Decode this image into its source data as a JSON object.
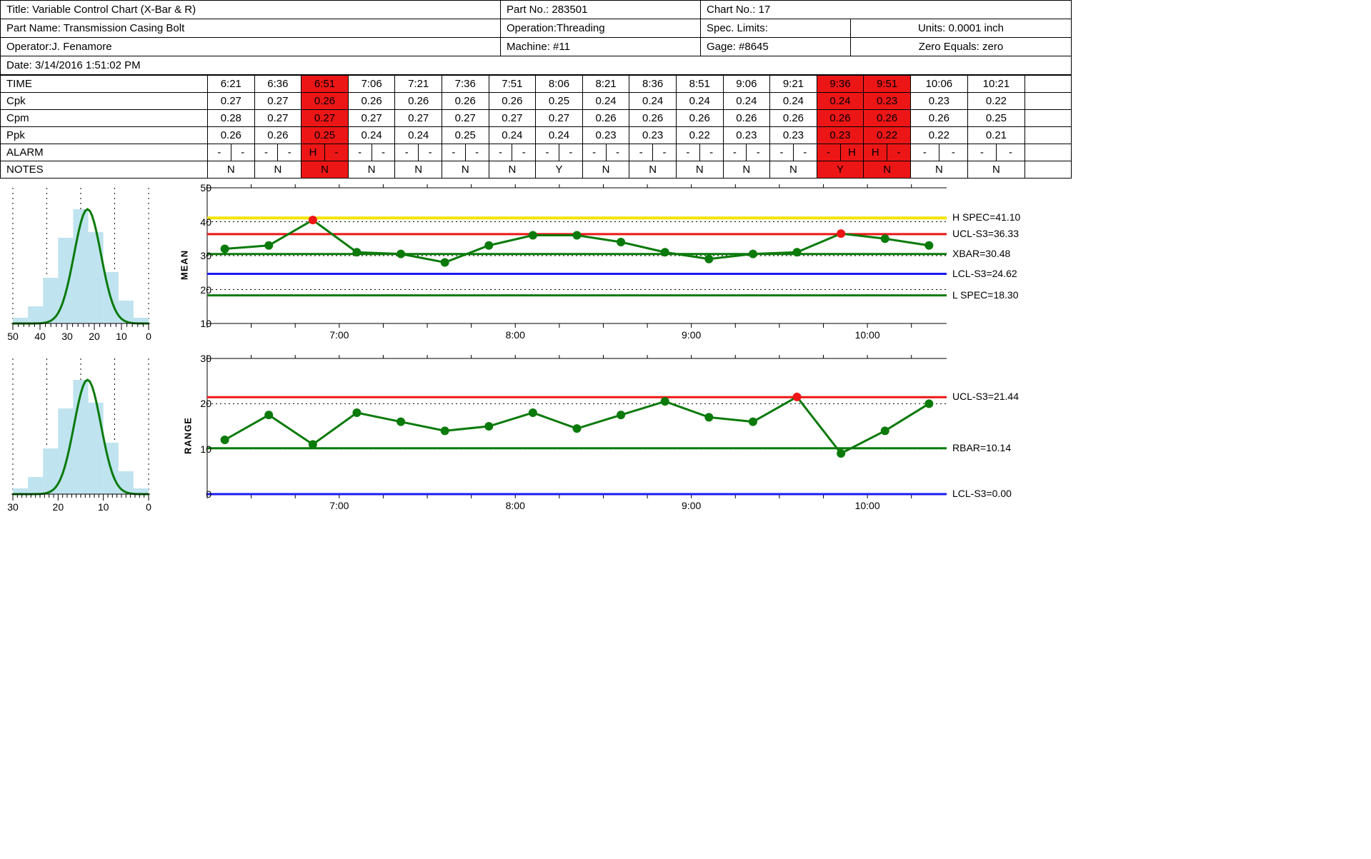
{
  "header": {
    "title": "Title: Variable Control Chart (X-Bar & R)",
    "partno": "Part No.: 283501",
    "chartno": "Chart No.: 17",
    "partname": "Part Name: Transmission Casing Bolt",
    "operation": "Operation:Threading",
    "speclimits": "Spec. Limits:",
    "units": "Units: 0.0001 inch",
    "operator": "Operator:J. Fenamore",
    "machine": "Machine: #11",
    "gage": "Gage: #8645",
    "zero": "Zero Equals: zero",
    "date": "Date: 3/14/2016 1:51:02 PM"
  },
  "rows": {
    "TIME": [
      "6:21",
      "6:36",
      "6:51",
      "7:06",
      "7:21",
      "7:36",
      "7:51",
      "8:06",
      "8:21",
      "8:36",
      "8:51",
      "9:06",
      "9:21",
      "9:36",
      "9:51",
      "10:06",
      "10:21"
    ],
    "Cpk": [
      "0.27",
      "0.27",
      "0.26",
      "0.26",
      "0.26",
      "0.26",
      "0.26",
      "0.25",
      "0.24",
      "0.24",
      "0.24",
      "0.24",
      "0.24",
      "0.24",
      "0.23",
      "0.23",
      "0.22"
    ],
    "Cpm": [
      "0.28",
      "0.27",
      "0.27",
      "0.27",
      "0.27",
      "0.27",
      "0.27",
      "0.27",
      "0.26",
      "0.26",
      "0.26",
      "0.26",
      "0.26",
      "0.26",
      "0.26",
      "0.26",
      "0.25"
    ],
    "Ppk": [
      "0.26",
      "0.26",
      "0.25",
      "0.24",
      "0.24",
      "0.25",
      "0.24",
      "0.24",
      "0.23",
      "0.23",
      "0.22",
      "0.23",
      "0.23",
      "0.23",
      "0.22",
      "0.22",
      "0.21"
    ],
    "ALARM": [
      [
        "-",
        "-"
      ],
      [
        "-",
        "-"
      ],
      [
        "H",
        "-"
      ],
      [
        "-",
        "-"
      ],
      [
        "-",
        "-"
      ],
      [
        "-",
        "-"
      ],
      [
        "-",
        "-"
      ],
      [
        "-",
        "-"
      ],
      [
        "-",
        "-"
      ],
      [
        "-",
        "-"
      ],
      [
        "-",
        "-"
      ],
      [
        "-",
        "-"
      ],
      [
        "-",
        "-"
      ],
      [
        "-",
        "H"
      ],
      [
        "H",
        "-"
      ],
      [
        "-",
        "-"
      ],
      [
        "-",
        "-"
      ]
    ],
    "NOTES": [
      "N",
      "N",
      "N",
      "N",
      "N",
      "N",
      "N",
      "Y",
      "N",
      "N",
      "N",
      "N",
      "N",
      "Y",
      "N",
      "N",
      "N"
    ]
  },
  "alarm_cols": [
    2,
    13,
    14
  ],
  "chart_data": {
    "mean": {
      "type": "line",
      "ylabel": "MEAN",
      "x_min": 6.25,
      "x_max": 10.45,
      "y_min": 10,
      "y_max": 50,
      "x_ticks": [
        7,
        8,
        9,
        10
      ],
      "x_ticklabels": [
        "7:00",
        "8:00",
        "9:00",
        "10:00"
      ],
      "y_ticks": [
        10,
        20,
        30,
        40,
        50
      ],
      "x": [
        6.35,
        6.6,
        6.85,
        7.1,
        7.35,
        7.6,
        7.85,
        8.1,
        8.35,
        8.6,
        8.85,
        9.1,
        9.35,
        9.6,
        9.85,
        10.1,
        10.35
      ],
      "y": [
        32,
        33,
        40.5,
        31,
        30.5,
        28,
        33,
        36,
        36,
        34,
        31,
        29,
        30.5,
        31,
        36.5,
        35,
        33
      ],
      "red_points": [
        2,
        14
      ],
      "lines": [
        {
          "y": 41.1,
          "color": "#f2e400",
          "w": 4,
          "label": "H SPEC=41.10"
        },
        {
          "y": 36.33,
          "color": "#ed1616",
          "w": 3,
          "label": "UCL-S3=36.33"
        },
        {
          "y": 30.48,
          "color": "#0a7a0a",
          "w": 3,
          "label": "XBAR=30.48"
        },
        {
          "y": 24.62,
          "color": "#1a1af2",
          "w": 3,
          "label": "LCL-S3=24.62"
        },
        {
          "y": 18.3,
          "color": "#0a7a0a",
          "w": 3,
          "label": "L SPEC=18.30"
        }
      ]
    },
    "range": {
      "type": "line",
      "ylabel": "RANGE",
      "x_min": 6.25,
      "x_max": 10.45,
      "y_min": 0,
      "y_max": 30,
      "x_ticks": [
        7,
        8,
        9,
        10
      ],
      "x_ticklabels": [
        "7:00",
        "8:00",
        "9:00",
        "10:00"
      ],
      "y_ticks": [
        0,
        10,
        20,
        30
      ],
      "x": [
        6.35,
        6.6,
        6.85,
        7.1,
        7.35,
        7.6,
        7.85,
        8.1,
        8.35,
        8.6,
        8.85,
        9.1,
        9.35,
        9.6,
        9.85,
        10.1,
        10.35
      ],
      "y": [
        12,
        17.5,
        11,
        18,
        16,
        14,
        15,
        18,
        14.5,
        17.5,
        20.5,
        17,
        16,
        21.5,
        9,
        14,
        20
      ],
      "red_points": [
        13
      ],
      "lines": [
        {
          "y": 21.44,
          "color": "#ed1616",
          "w": 3,
          "label": "UCL-S3=21.44"
        },
        {
          "y": 10.14,
          "color": "#0a7a0a",
          "w": 3,
          "label": "RBAR=10.14"
        },
        {
          "y": 0.0,
          "color": "#1a1af2",
          "w": 3,
          "label": "LCL-S3=0.00"
        }
      ]
    },
    "histo_mean": {
      "axis_min": 0,
      "axis_max": 50,
      "ticks": [
        0,
        10,
        20,
        30,
        40,
        50
      ]
    },
    "histo_range": {
      "axis_min": 0,
      "axis_max": 30,
      "ticks": [
        0,
        10,
        20,
        30
      ]
    }
  }
}
